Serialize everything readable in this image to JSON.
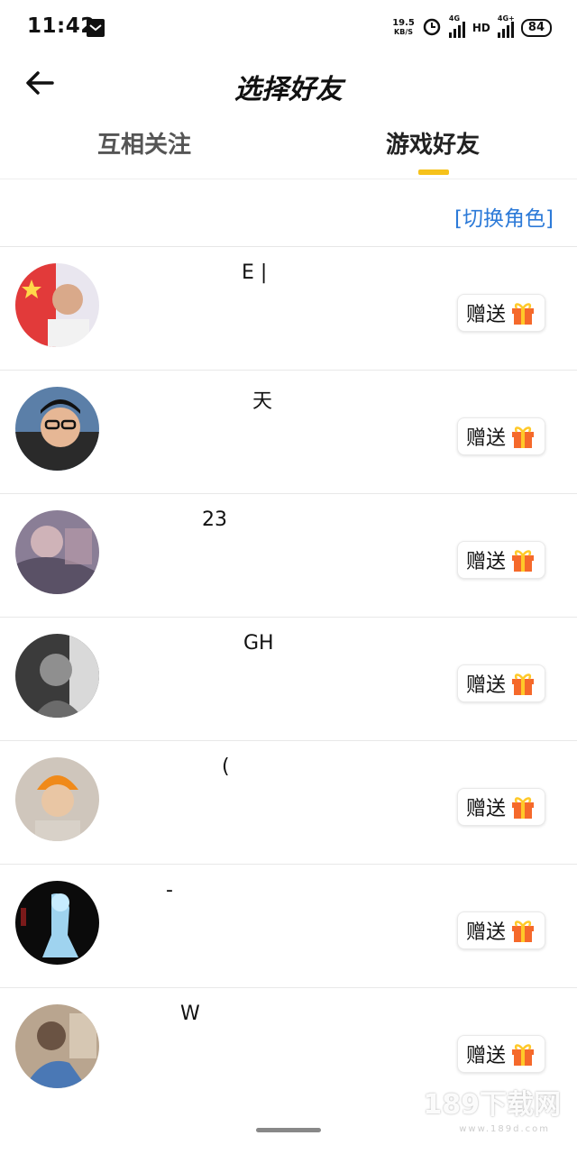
{
  "status_bar": {
    "time": "11:42",
    "net_speed_value": "19.5",
    "net_speed_unit": "KB/S",
    "battery": "84",
    "sim1": "4G",
    "sim2": "4G+"
  },
  "header": {
    "title": "选择好友"
  },
  "tabs": [
    {
      "label": "互相关注",
      "active": false
    },
    {
      "label": "游戏好友",
      "active": true
    }
  ],
  "switch_role": "[切换角色]",
  "friends": [
    {
      "name": "E |",
      "gift_label": "赠送"
    },
    {
      "name": "天",
      "gift_label": "赠送"
    },
    {
      "name": "23",
      "gift_label": "赠送"
    },
    {
      "name": "GH",
      "gift_label": "赠送"
    },
    {
      "name": "(",
      "gift_label": "赠送"
    },
    {
      "name": "‑",
      "gift_label": "赠送"
    },
    {
      "name": "W",
      "gift_label": "赠送"
    }
  ],
  "watermark": {
    "text": "189下载网",
    "sub": "www.189d.com"
  },
  "colors": {
    "accent_tab_indicator": "#f6c21b",
    "link_blue": "#2c7ad8",
    "gift_orange": "#f5692b"
  }
}
